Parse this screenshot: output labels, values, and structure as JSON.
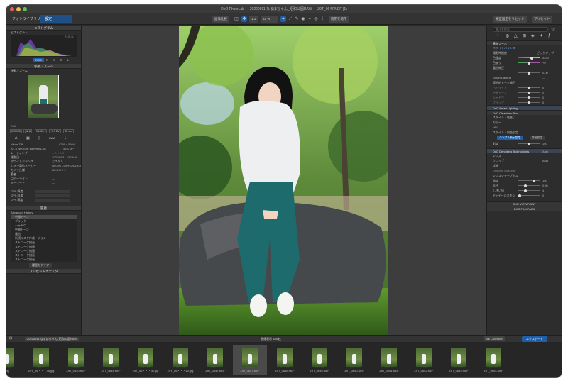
{
  "window": {
    "title": "DxO PhotoLab — 20220911 なるほちゃん_昭和公園RAW — Z9T_0647.NEF (1)"
  },
  "toolbar": {
    "tab_library": "フォトライブラリ",
    "tab_customize": "設定",
    "compare": "画像比較",
    "fit": "1:1",
    "zoom": "32 %",
    "apply": "適用を適用",
    "reset": "補正設定をリセット",
    "presets": "プリセット"
  },
  "left": {
    "histogram_header": "ヒストグラム",
    "histogram_label": "ヒストグラム",
    "histo_rgb": "R- G- B-",
    "histo_tabs": [
      "RGB",
      "R",
      "G",
      "B",
      "L"
    ],
    "nav_header": "移動／ズーム",
    "nav_label": "移動／ズーム",
    "exif_label": "Exif",
    "exif_chips": [
      "ISO 100",
      "ƒ/2.8",
      "1/1600 s",
      "+0.0 EV",
      "85 mm"
    ],
    "exif_mode": "RAW",
    "camera": "Nikon Z 9",
    "size": "8256 x 5504",
    "lens": "AF-S NIKKOR 85mm f/1.4G",
    "megapixels": "45.4 MP",
    "rows": [
      {
        "k": "レーティング",
        "v": "☆☆☆☆☆"
      },
      {
        "k": "撮影日",
        "v": "2022/09/11 13:09:26"
      },
      {
        "k": "ホワイトバランス",
        "v": "カスタム"
      },
      {
        "k": "カメラ製造メーカー",
        "v": "NIKON CORPORATION"
      },
      {
        "k": "カメラ仕様",
        "v": "NIKON Z 9"
      },
      {
        "k": "著者",
        "v": "—"
      },
      {
        "k": "コピーライト",
        "v": "—"
      },
      {
        "k": "キーワード",
        "v": "—"
      }
    ],
    "gps": [
      "GPS 緯度",
      "GPS 経度",
      "GPS 高度"
    ],
    "history_header": "履歴",
    "history_label": "Advanced History",
    "history_items": [
      "中間トーン",
      "ブラック",
      "シャドウ",
      "中間トーン",
      "露出",
      "新規マスク作成・ブラシ",
      "ストローク描画",
      "ストローク描画",
      "ストローク描画",
      "ストローク描画",
      "ストローク描画"
    ],
    "history_clear": "履歴をクリア",
    "preset_header": "プリセットエディタ"
  },
  "right": {
    "search_placeholder": "補正を検索",
    "basic": "基本ツール",
    "wb": "ホワイトバランス",
    "wb_preset": "撮影時設定",
    "wb_picker": "ピックアップ",
    "temp": "色温度",
    "temp_v": "5250",
    "tint": "色被り",
    "tint_v": "+0",
    "exposure_sec": "露出補正",
    "exposure_v": "0.00",
    "smart": "Smart Lighting",
    "smart_v": "—",
    "contrast_sec": "選択的トーン補正",
    "tones": [
      {
        "k": "ハイライト",
        "v": "0"
      },
      {
        "k": "中間トーン",
        "v": "0"
      },
      {
        "k": "シャドウ",
        "v": "0"
      },
      {
        "k": "ブラック",
        "v": "0"
      }
    ],
    "smart_header": "DxO Smart Lighting",
    "clearview": "DxO ClearView Plus",
    "style": "スタイル・色合い",
    "color": "カラー",
    "hsl": "HSL",
    "filmlook": "スタイル・調色設定",
    "mode1": "シンプル表示設定",
    "mode2": "詳細設定",
    "sat_label": "彩度",
    "sat_v": "100",
    "denoise": "DxO Denoising Technologies",
    "denoise_v": "Auto",
    "lens_sec": "レンズ",
    "crop": "クロップ",
    "crop_v": "Auto",
    "detail": "詳細",
    "detail_sub": "Unsharp Masking",
    "lens_sharp": "レンズシャープネス",
    "sharp_rows": [
      {
        "k": "強度",
        "v": "100"
      },
      {
        "k": "半径",
        "v": "0.50"
      },
      {
        "k": "しきい値",
        "v": "4"
      }
    ],
    "bokeh": "ディテールオキシ",
    "bokeh_v": "0",
    "viewpoint": "DXO VIEWPOINT",
    "filmpack": "DXO FILMPACK"
  },
  "filmstrip": {
    "folder": "20220911 なるほちゃん_昭和公園RAW",
    "count": "画像表示 1/46枚",
    "nik": "Nik Collection",
    "export": "エクスポート",
    "items": [
      "_jpg",
      "Z9T_06・・・38.jpg",
      "Z9T_0640.NEF",
      "Z9T_0644.NEF",
      "Z9T_06・・・36.jpg",
      "Z9T_06・・・10.jpg",
      "Z9T_0647.NEF",
      "Z9T_0647.NEF",
      "Z9T_0648.NEF",
      "Z9T_0649.NEF",
      "Z9T_0650.NEF",
      "Z9T_0651.NEF",
      "Z9T_0652.NEF",
      "Z9T_0653.NEF",
      "Z9T_0654.NEF"
    ]
  }
}
